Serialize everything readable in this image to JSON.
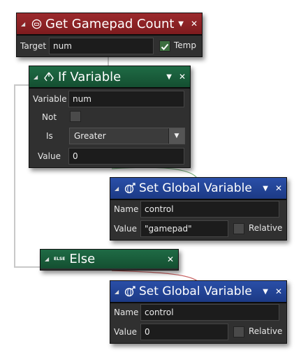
{
  "get_gamepad": {
    "title": "Get Gamepad Count",
    "target_label": "Target",
    "target_value": "num",
    "temp_label": "Temp"
  },
  "if_variable": {
    "title": "If Variable",
    "variable_label": "Variable",
    "variable_value": "num",
    "not_label": "Not",
    "is_label": "Is",
    "is_value": "Greater",
    "value_label": "Value",
    "value_value": "0"
  },
  "set_global_1": {
    "title": "Set Global Variable",
    "name_label": "Name",
    "name_value": "control",
    "value_label": "Value",
    "value_value": "\"gamepad\"",
    "relative_label": "Relative"
  },
  "else_block": {
    "tag": "ELSE",
    "title": "Else"
  },
  "set_global_2": {
    "title": "Set Global Variable",
    "name_label": "Name",
    "name_value": "control",
    "value_label": "Value",
    "value_value": "0",
    "relative_label": "Relative"
  },
  "colors": {
    "event_red": "#8b2225",
    "control_green": "#1a5c3b",
    "action_blue": "#2447a0",
    "panel_dark": "#303030"
  }
}
